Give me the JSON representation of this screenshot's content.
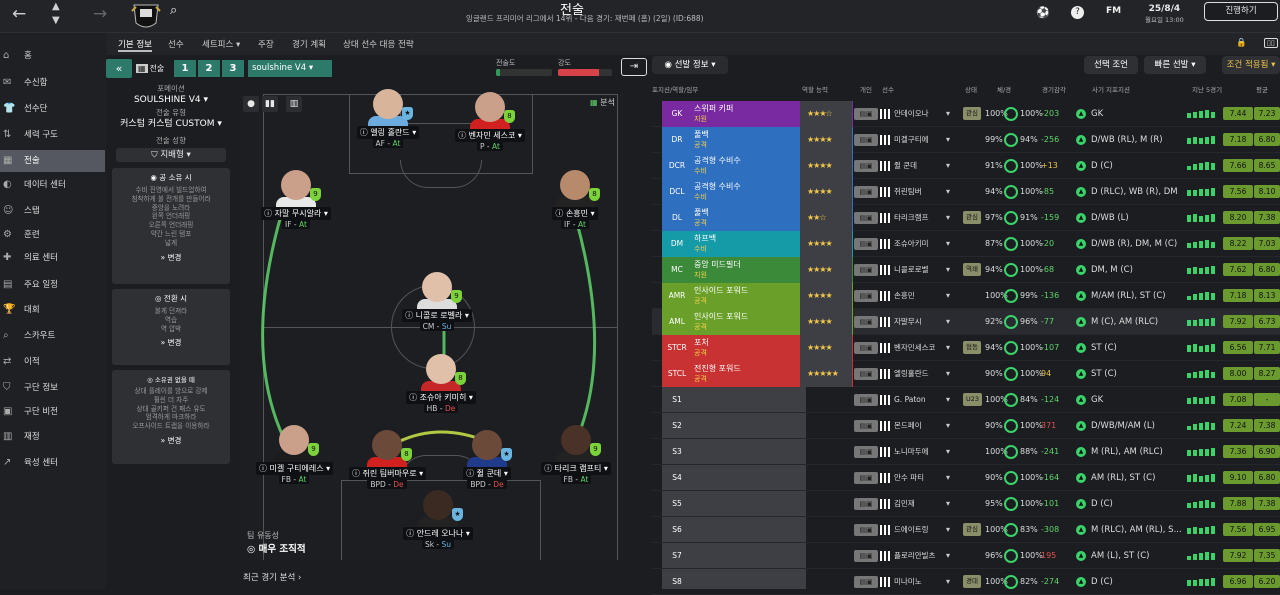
{
  "topbar": {
    "title": "전술",
    "subtitle": "잉글랜드 프리미어 리그에서 14위 - 다음 경기: 재번페 (홈) (2일) (ID:688)",
    "date": "25/8/4",
    "time": "월요일 13:00",
    "continue_label": "진행하기",
    "fm_label": "FM"
  },
  "sidebar": [
    {
      "icon": "home-icon",
      "label": "홈",
      "glyph": "⌂"
    },
    {
      "icon": "inbox-icon",
      "label": "수신함",
      "glyph": "✉"
    },
    {
      "icon": "squad-icon",
      "label": "선수단",
      "glyph": "👕"
    },
    {
      "icon": "dynamics-icon",
      "label": "세력 구도",
      "glyph": "⇅"
    },
    {
      "icon": "tactics-icon",
      "label": "전술",
      "glyph": "▦",
      "active": true
    },
    {
      "icon": "data-hub-icon",
      "label": "데이터 센터",
      "glyph": "◐"
    },
    {
      "icon": "staff-icon",
      "label": "스탭",
      "glyph": "☺"
    },
    {
      "icon": "training-icon",
      "label": "훈련",
      "glyph": "⚙"
    },
    {
      "icon": "medical-icon",
      "label": "의료 센터",
      "glyph": "✚"
    },
    {
      "icon": "schedule-icon",
      "label": "주요 일정",
      "glyph": "▤"
    },
    {
      "icon": "competitions-icon",
      "label": "대회",
      "glyph": "🏆"
    },
    {
      "icon": "scouting-icon",
      "label": "스카우트",
      "glyph": "⌕"
    },
    {
      "icon": "transfers-icon",
      "label": "이적",
      "glyph": "⇄"
    },
    {
      "icon": "club-info-icon",
      "label": "구단 정보",
      "glyph": "⛉"
    },
    {
      "icon": "club-vision-icon",
      "label": "구단 비전",
      "glyph": "▣"
    },
    {
      "icon": "finances-icon",
      "label": "재정",
      "glyph": "▥"
    },
    {
      "icon": "dev-centre-icon",
      "label": "육성 센터",
      "glyph": "↗"
    }
  ],
  "subtabs": [
    "기본 정보",
    "선수",
    "세트피스 ▾",
    "주장",
    "경기 계획",
    "상대 선수 대응 전략"
  ],
  "tactic_bar": {
    "label": "전술",
    "numbers": [
      "1",
      "2",
      "3"
    ],
    "selected": "soulshine V4",
    "cohesion_label": "전술도",
    "intensity_label": "강도"
  },
  "left_panel": {
    "formation_label": "포메이션",
    "formation": "SOULSHINE V4 ▾",
    "style_label": "전술 유형",
    "style": "커스텀 커스텀 CUSTOM ▾",
    "mentality_label": "전술 성향",
    "mentality": "지배형",
    "in_possession": {
      "title": "공 소유 시",
      "lines": [
        "수비 진영에서 빌드업하여",
        "침착하게 볼 전개를 만들어라",
        "중앙을 노려라",
        "왼쪽 언더래핑",
        "오른쪽 언더래핑",
        "약간 느린 템포",
        "넓게"
      ],
      "button": "변경"
    },
    "in_transition": {
      "title": "전환 시",
      "lines": [
        "볼게 던져라",
        "역습",
        "역 압박"
      ],
      "button": "변경"
    },
    "out_possession": {
      "title": "소유권 없을 때",
      "lines": [
        "상대 플레이를 방으로 강제",
        "훨씬 더 자주",
        "상대 골키퍼 건 패스 유도",
        "엄격하게 마크하라",
        "오프사이드 트랩을 이용하라"
      ],
      "button": "변경"
    }
  },
  "pitch": {
    "analysis_label": "분석",
    "fluidity_label": "팀 유동성",
    "fluidity": "매우 조직적",
    "recent_label": "최근 경기 분석"
  },
  "players": [
    {
      "name": "엘링 홀란드",
      "role": "AF",
      "duty": "At",
      "badge": "★",
      "badge_color": "#6ab4e0",
      "face": "#d8b49a",
      "shirt": "#6cabdd"
    },
    {
      "name": "벤자민 세스코",
      "role": "P",
      "duty": "At",
      "badge": "8",
      "badge_color": "#7bd23a",
      "face": "#caa08a",
      "shirt": "#d02020"
    },
    {
      "name": "자말 무시알라",
      "role": "IF",
      "duty": "At",
      "badge": "9",
      "badge_color": "#7bd23a",
      "face": "#caa08a",
      "shirt": "#e8e8e8"
    },
    {
      "name": "손흥민",
      "role": "IF",
      "duty": "At",
      "badge": "8",
      "badge_color": "#7bd23a",
      "face": "#b88a6c",
      "shirt": "#222"
    },
    {
      "name": "니콜로 로벨라",
      "role": "CM",
      "duty": "Su",
      "badge": "9",
      "badge_color": "#7bd23a",
      "face": "#e0c0a8",
      "shirt": "#ddd"
    },
    {
      "name": "조슈아 키미히",
      "role": "HB",
      "duty": "De",
      "badge": "8",
      "badge_color": "#7bd23a",
      "face": "#e0c0a8",
      "shirt": "#c62828"
    },
    {
      "name": "미겔 구티에레스",
      "role": "FB",
      "duty": "At",
      "badge": "9",
      "badge_color": "#7bd23a",
      "face": "#caa08a",
      "shirt": "#1c1c1c"
    },
    {
      "name": "쥘 쿤데",
      "role": "BPD",
      "duty": "De",
      "badge": "★",
      "badge_color": "#6ab4e0",
      "face": "#6b4a3a",
      "shirt": "#1f3b8a"
    },
    {
      "name": "쥐린 팀버마우로",
      "role": "BPD",
      "duty": "De",
      "badge": "8",
      "badge_color": "#7bd23a",
      "face": "#6b4a3a",
      "shirt": "#d02020"
    },
    {
      "name": "타리크 램프티",
      "role": "FB",
      "duty": "At",
      "badge": "9",
      "badge_color": "#7bd23a",
      "face": "#4a3228",
      "shirt": "#222"
    },
    {
      "name": "안드레 오나나",
      "role": "Sk",
      "duty": "Su",
      "badge": "★",
      "badge_color": "#6ab4e0",
      "face": "#3a2a22",
      "shirt": "#222"
    }
  ],
  "right_panel": {
    "selection_info": "선발 정보",
    "btn_advice": "선택 조언",
    "btn_quick": "빠른 선발",
    "btn_rules": "조건 적용됨",
    "headers": [
      "포지션/역할/임무",
      "역할 능력",
      "개인",
      "선수",
      "상태",
      "체/경",
      "경기감각",
      "가치",
      "사기 지포지션",
      "지난 5경기",
      "평균"
    ]
  },
  "rows": [
    {
      "pos": "GK",
      "role": "스위퍼 키퍼",
      "duty": "지원",
      "color": "#7a2aa0",
      "stars": "★★★☆",
      "name": "안데이오나",
      "status": "관심",
      "cond": "100%",
      "sharp": "100%",
      "value": "-203",
      "ppos": "GK",
      "rating": "7.44",
      "avg": "7.23"
    },
    {
      "pos": "DR",
      "role": "풀백",
      "duty": "공격",
      "color": "#2f6fc0",
      "stars": "★★★★",
      "name": "미겔구티에",
      "status": "",
      "cond": "99%",
      "sharp": "94%",
      "value": "-256",
      "ppos": "D/WB (RL), M (R)",
      "rating": "7.18",
      "avg": "6.80"
    },
    {
      "pos": "DCR",
      "role": "공격형 수비수",
      "duty": "수비",
      "color": "#2f6fc0",
      "stars": "★★★★",
      "name": "쥘 쿤데",
      "status": "",
      "cond": "91%",
      "sharp": "100%",
      "value": "+13",
      "ppos": "D (C)",
      "rating": "7.66",
      "avg": "8.65"
    },
    {
      "pos": "DCL",
      "role": "공격형 수비수",
      "duty": "수비",
      "color": "#2f6fc0",
      "stars": "★★★★",
      "name": "쥐린팀버",
      "status": "",
      "cond": "94%",
      "sharp": "100%",
      "value": "-85",
      "ppos": "D (RLC), WB (R), DM",
      "rating": "7.56",
      "avg": "8.10"
    },
    {
      "pos": "DL",
      "role": "풀백",
      "duty": "공격",
      "color": "#2f6fc0",
      "stars": "★★☆",
      "name": "타리크램프",
      "status": "관심",
      "cond": "97%",
      "sharp": "91%",
      "value": "-159",
      "ppos": "D/WB (L)",
      "rating": "8.20",
      "avg": "7.38"
    },
    {
      "pos": "DM",
      "role": "하프백",
      "duty": "수비",
      "color": "#159aa8",
      "stars": "★★★★",
      "name": "조슈아키미",
      "status": "",
      "cond": "87%",
      "sharp": "100%",
      "value": "-20",
      "ppos": "D/WB (R), DM, M (C)",
      "rating": "8.22",
      "avg": "7.03"
    },
    {
      "pos": "MC",
      "role": "중앙 미드필더",
      "duty": "지원",
      "color": "#3a8a3a",
      "stars": "★★★★",
      "name": "니콜로로벨",
      "status": "역쇄",
      "cond": "94%",
      "sharp": "100%",
      "value": "-68",
      "ppos": "DM, M (C)",
      "rating": "7.62",
      "avg": "6.80"
    },
    {
      "pos": "AMR",
      "role": "인사이드 포워드",
      "duty": "공격",
      "color": "#6aa02a",
      "stars": "★★★★",
      "name": "손흥민",
      "status": "",
      "cond": "100%",
      "sharp": "99%",
      "value": "-136",
      "ppos": "M/AM (RL), ST (C)",
      "rating": "7.18",
      "avg": "8.13"
    },
    {
      "pos": "AML",
      "role": "인사이드 포워드",
      "duty": "공격",
      "color": "#6aa02a",
      "stars": "★★★★",
      "name": "자말무시",
      "status": "",
      "cond": "92%",
      "sharp": "96%",
      "value": "-77",
      "ppos": "M (C), AM (RLC)",
      "rating": "7.92",
      "avg": "6.73"
    },
    {
      "pos": "STCR",
      "role": "포처",
      "duty": "공격",
      "color": "#c83232",
      "stars": "★★★★",
      "name": "벤자민세스코",
      "status": "협동",
      "cond": "94%",
      "sharp": "100%",
      "value": "-107",
      "ppos": "ST (C)",
      "rating": "6.56",
      "avg": "7.71"
    },
    {
      "pos": "STCL",
      "role": "전진형 포워드",
      "duty": "공격",
      "color": "#c83232",
      "stars": "★★★★★",
      "name": "엘링홀란드",
      "status": "",
      "cond": "90%",
      "sharp": "100%",
      "value": "94",
      "ppos": "ST (C)",
      "rating": "8.00",
      "avg": "8.27"
    },
    {
      "pos": "S1",
      "role": "",
      "duty": "",
      "color": "",
      "stars": "",
      "name": "G. Paton",
      "status": "U23",
      "cond": "100%",
      "sharp": "84%",
      "value": "-124",
      "ppos": "GK",
      "rating": "7.08",
      "avg": "-"
    },
    {
      "pos": "S2",
      "role": "",
      "duty": "",
      "color": "",
      "stars": "",
      "name": "몬드페이",
      "status": "",
      "cond": "90%",
      "sharp": "100%",
      "value": "371",
      "ppos": "D/WB/M/AM (L)",
      "rating": "7.24",
      "avg": "7.38"
    },
    {
      "pos": "S3",
      "role": "",
      "duty": "",
      "color": "",
      "stars": "",
      "name": "노니마두에",
      "status": "",
      "cond": "100%",
      "sharp": "88%",
      "value": "-241",
      "ppos": "M (RL), AM (RLC)",
      "rating": "7.36",
      "avg": "6.90"
    },
    {
      "pos": "S4",
      "role": "",
      "duty": "",
      "color": "",
      "stars": "",
      "name": "안수 파티",
      "status": "",
      "cond": "90%",
      "sharp": "100%",
      "value": "-164",
      "ppos": "AM (RL), ST (C)",
      "rating": "9.10",
      "avg": "6.80"
    },
    {
      "pos": "S5",
      "role": "",
      "duty": "",
      "color": "",
      "stars": "",
      "name": "김민재",
      "status": "",
      "cond": "95%",
      "sharp": "100%",
      "value": "-101",
      "ppos": "D (C)",
      "rating": "7.88",
      "avg": "7.38"
    },
    {
      "pos": "S6",
      "role": "",
      "duty": "",
      "color": "",
      "stars": "",
      "name": "드에이트링",
      "status": "관심",
      "cond": "100%",
      "sharp": "83%",
      "value": "-308",
      "ppos": "M (RLC), AM (RL), S...",
      "rating": "7.56",
      "avg": "6.95"
    },
    {
      "pos": "S7",
      "role": "",
      "duty": "",
      "color": "",
      "stars": "",
      "name": "플로리안빌츠",
      "status": "",
      "cond": "96%",
      "sharp": "100%",
      "value": "195",
      "ppos": "AM (L), ST (C)",
      "rating": "7.92",
      "avg": "7.35"
    },
    {
      "pos": "S8",
      "role": "",
      "duty": "",
      "color": "",
      "stars": "",
      "name": "미나미노",
      "status": "경대",
      "cond": "100%",
      "sharp": "82%",
      "value": "-274",
      "ppos": "D (C)",
      "rating": "6.96",
      "avg": "6.20"
    }
  ]
}
